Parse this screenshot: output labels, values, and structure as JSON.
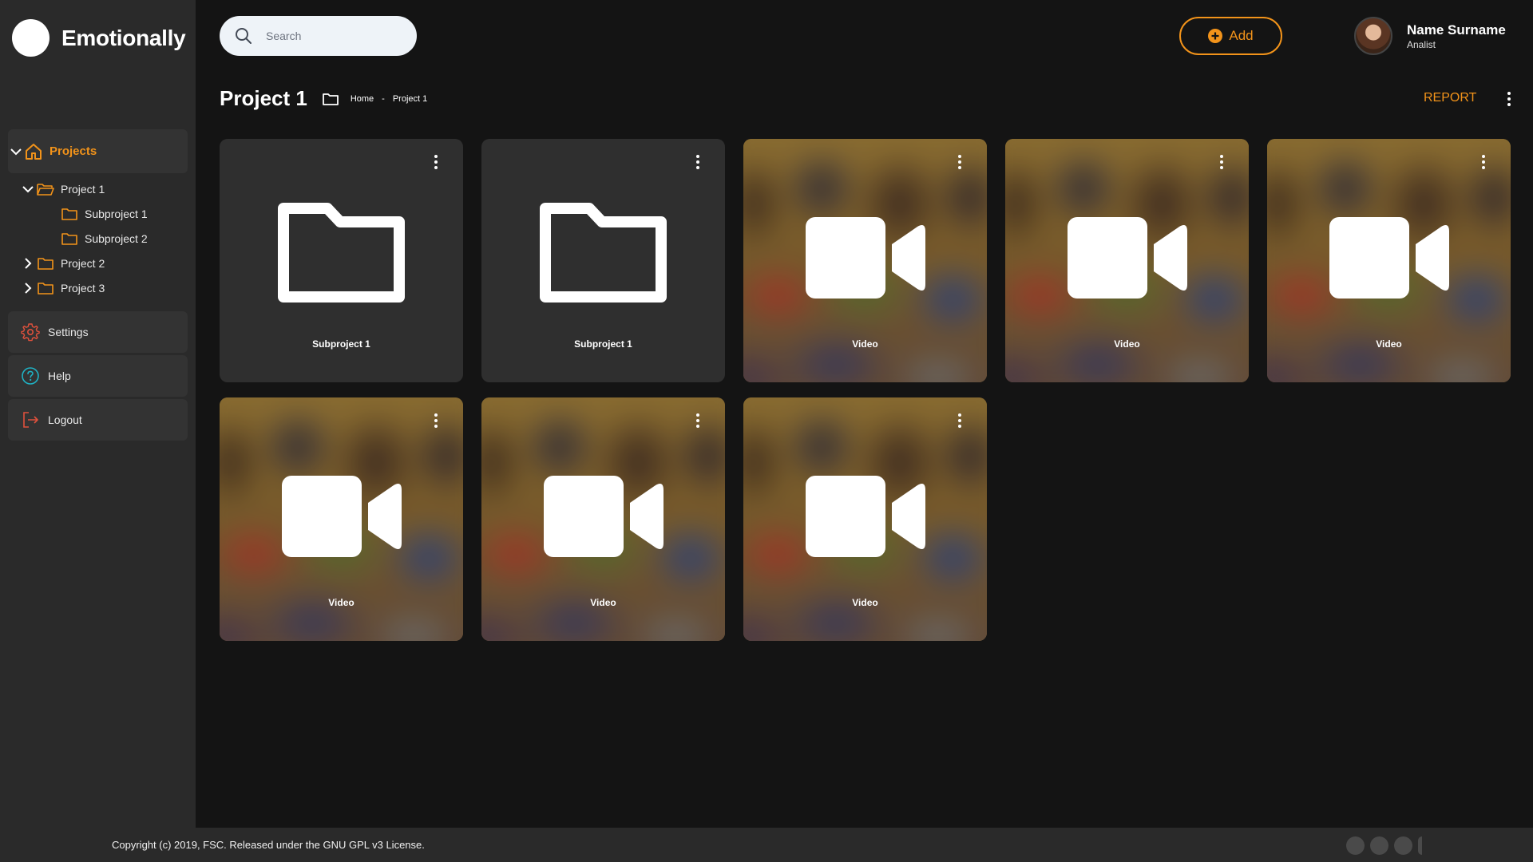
{
  "brand": {
    "name": "Emotionally"
  },
  "search": {
    "placeholder": "Search"
  },
  "header": {
    "add_label": "Add",
    "user_name": "Name Surname",
    "user_role": "Analist"
  },
  "sidebar": {
    "projects_label": "Projects",
    "tree": [
      {
        "label": "Project 1",
        "level": 1,
        "expanded": true
      },
      {
        "label": "Subproject 1",
        "level": 2
      },
      {
        "label": "Subproject 2",
        "level": 2
      },
      {
        "label": "Project 2",
        "level": 1,
        "expanded": false
      },
      {
        "label": "Project 3",
        "level": 1,
        "expanded": false
      }
    ],
    "settings_label": "Settings",
    "help_label": "Help",
    "logout_label": "Logout"
  },
  "page": {
    "title": "Project 1",
    "breadcrumb": [
      "Home",
      "Project 1"
    ],
    "breadcrumb_sep": "-",
    "report_label": "REPORT"
  },
  "cards": [
    {
      "type": "folder",
      "label": "Subproject 1"
    },
    {
      "type": "folder",
      "label": "Subproject 1"
    },
    {
      "type": "video",
      "label": "Video"
    },
    {
      "type": "video",
      "label": "Video"
    },
    {
      "type": "video",
      "label": "Video"
    },
    {
      "type": "video",
      "label": "Video"
    },
    {
      "type": "video",
      "label": "Video"
    },
    {
      "type": "video",
      "label": "Video"
    }
  ],
  "footer": {
    "copyright": "Copyright (c) 2019, FSC. Released under the GNU GPL v3 License."
  },
  "colors": {
    "accent": "#f2931a",
    "sidebar": "#2a2a2a",
    "background": "#141414",
    "card": "#2f2f2f",
    "settings_icon": "#e0513c",
    "help_icon": "#1fb2c4",
    "logout_icon": "#e0513c"
  }
}
